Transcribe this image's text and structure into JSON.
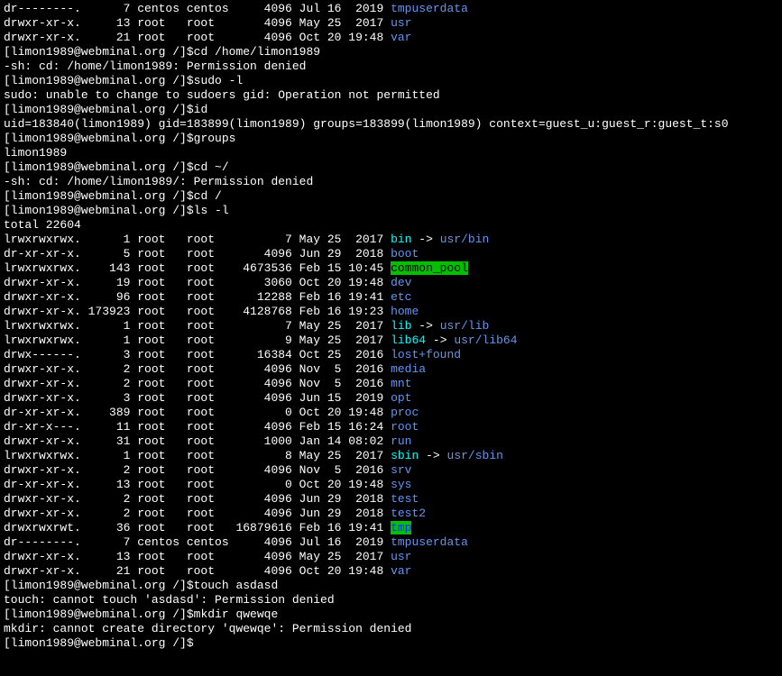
{
  "prompt": "[limon1989@webminal.org /]$",
  "pre_listing": [
    {
      "perm": "dr--------.",
      "links": "7",
      "owner": "centos",
      "group": "centos",
      "size": "4096",
      "date": "Jul 16  2019",
      "name": "tmpuserdata",
      "cls": "blue"
    },
    {
      "perm": "drwxr-xr-x.",
      "links": "13",
      "owner": "root",
      "group": "root",
      "size": "4096",
      "date": "May 25  2017",
      "name": "usr",
      "cls": "blue"
    },
    {
      "perm": "drwxr-xr-x.",
      "links": "21",
      "owner": "root",
      "group": "root",
      "size": "4096",
      "date": "Oct 20 19:48",
      "name": "var",
      "cls": "blue"
    }
  ],
  "cmds": {
    "cd_home": "cd /home/limon1989",
    "cd_home_out": "-sh: cd: /home/limon1989: Permission denied",
    "sudo_l": "sudo -l",
    "sudo_out": "sudo: unable to change to sudoers gid: Operation not permitted",
    "id": "id",
    "id_out": "uid=183840(limon1989) gid=183899(limon1989) groups=183899(limon1989) context=guest_u:guest_r:guest_t:s0",
    "groups": "groups",
    "groups_out": "limon1989",
    "cd_tilde": "cd ~/",
    "cd_tilde_out": "-sh: cd: /home/limon1989/: Permission denied",
    "cd_root": "cd /",
    "ls_l": "ls -l",
    "total": "total 22604",
    "touch": "touch asdasd",
    "touch_out": "touch: cannot touch 'asdasd': Permission denied",
    "mkdir": "mkdir qwewqe",
    "mkdir_out": "mkdir: cannot create directory 'qwewqe': Permission denied"
  },
  "listing": [
    {
      "perm": "lrwxrwxrwx.",
      "links": "1",
      "owner": "root",
      "group": "root",
      "size": "7",
      "date": "May 25  2017",
      "name": "bin",
      "cls": "cyan",
      "arrow": " -> ",
      "target": "usr/bin",
      "tcls": "blue"
    },
    {
      "perm": "dr-xr-xr-x.",
      "links": "5",
      "owner": "root",
      "group": "root",
      "size": "4096",
      "date": "Jun 29  2018",
      "name": "boot",
      "cls": "blue"
    },
    {
      "perm": "lrwxrwxrwx.",
      "links": "143",
      "owner": "root",
      "group": "root",
      "size": "4673536",
      "date": "Feb 15 10:45",
      "name": "common_pool",
      "cls": "green-bg"
    },
    {
      "perm": "drwxr-xr-x.",
      "links": "19",
      "owner": "root",
      "group": "root",
      "size": "3060",
      "date": "Oct 20 19:48",
      "name": "dev",
      "cls": "blue"
    },
    {
      "perm": "drwxr-xr-x.",
      "links": "96",
      "owner": "root",
      "group": "root",
      "size": "12288",
      "date": "Feb 16 19:41",
      "name": "etc",
      "cls": "blue"
    },
    {
      "perm": "drwxr-xr-x.",
      "links": "173923",
      "owner": "root",
      "group": "root",
      "size": "4128768",
      "date": "Feb 16 19:23",
      "name": "home",
      "cls": "blue"
    },
    {
      "perm": "lrwxrwxrwx.",
      "links": "1",
      "owner": "root",
      "group": "root",
      "size": "7",
      "date": "May 25  2017",
      "name": "lib",
      "cls": "cyan",
      "arrow": " -> ",
      "target": "usr/lib",
      "tcls": "blue"
    },
    {
      "perm": "lrwxrwxrwx.",
      "links": "1",
      "owner": "root",
      "group": "root",
      "size": "9",
      "date": "May 25  2017",
      "name": "lib64",
      "cls": "cyan",
      "arrow": " -> ",
      "target": "usr/lib64",
      "tcls": "blue"
    },
    {
      "perm": "drwx------.",
      "links": "3",
      "owner": "root",
      "group": "root",
      "size": "16384",
      "date": "Oct 25  2016",
      "name": "lost+found",
      "cls": "blue"
    },
    {
      "perm": "drwxr-xr-x.",
      "links": "2",
      "owner": "root",
      "group": "root",
      "size": "4096",
      "date": "Nov  5  2016",
      "name": "media",
      "cls": "blue"
    },
    {
      "perm": "drwxr-xr-x.",
      "links": "2",
      "owner": "root",
      "group": "root",
      "size": "4096",
      "date": "Nov  5  2016",
      "name": "mnt",
      "cls": "blue"
    },
    {
      "perm": "drwxr-xr-x.",
      "links": "3",
      "owner": "root",
      "group": "root",
      "size": "4096",
      "date": "Jun 15  2019",
      "name": "opt",
      "cls": "blue"
    },
    {
      "perm": "dr-xr-xr-x.",
      "links": "389",
      "owner": "root",
      "group": "root",
      "size": "0",
      "date": "Oct 20 19:48",
      "name": "proc",
      "cls": "blue"
    },
    {
      "perm": "dr-xr-x---.",
      "links": "11",
      "owner": "root",
      "group": "root",
      "size": "4096",
      "date": "Feb 15 16:24",
      "name": "root",
      "cls": "blue"
    },
    {
      "perm": "drwxr-xr-x.",
      "links": "31",
      "owner": "root",
      "group": "root",
      "size": "1000",
      "date": "Jan 14 08:02",
      "name": "run",
      "cls": "blue"
    },
    {
      "perm": "lrwxrwxrwx.",
      "links": "1",
      "owner": "root",
      "group": "root",
      "size": "8",
      "date": "May 25  2017",
      "name": "sbin",
      "cls": "cyan",
      "arrow": " -> ",
      "target": "usr/sbin",
      "tcls": "blue"
    },
    {
      "perm": "drwxr-xr-x.",
      "links": "2",
      "owner": "root",
      "group": "root",
      "size": "4096",
      "date": "Nov  5  2016",
      "name": "srv",
      "cls": "blue"
    },
    {
      "perm": "dr-xr-xr-x.",
      "links": "13",
      "owner": "root",
      "group": "root",
      "size": "0",
      "date": "Oct 20 19:48",
      "name": "sys",
      "cls": "blue"
    },
    {
      "perm": "drwxr-xr-x.",
      "links": "2",
      "owner": "root",
      "group": "root",
      "size": "4096",
      "date": "Jun 29  2018",
      "name": "test",
      "cls": "blue"
    },
    {
      "perm": "drwxr-xr-x.",
      "links": "2",
      "owner": "root",
      "group": "root",
      "size": "4096",
      "date": "Jun 29  2018",
      "name": "test2",
      "cls": "blue"
    },
    {
      "perm": "drwxrwxrwt.",
      "links": "36",
      "owner": "root",
      "group": "root",
      "size": "16879616",
      "date": "Feb 16 19:41",
      "name": "tmp",
      "cls": "green-bg-blue"
    },
    {
      "perm": "dr--------.",
      "links": "7",
      "owner": "centos",
      "group": "centos",
      "size": "4096",
      "date": "Jul 16  2019",
      "name": "tmpuserdata",
      "cls": "blue"
    },
    {
      "perm": "drwxr-xr-x.",
      "links": "13",
      "owner": "root",
      "group": "root",
      "size": "4096",
      "date": "May 25  2017",
      "name": "usr",
      "cls": "blue"
    },
    {
      "perm": "drwxr-xr-x.",
      "links": "21",
      "owner": "root",
      "group": "root",
      "size": "4096",
      "date": "Oct 20 19:48",
      "name": "var",
      "cls": "blue"
    }
  ]
}
